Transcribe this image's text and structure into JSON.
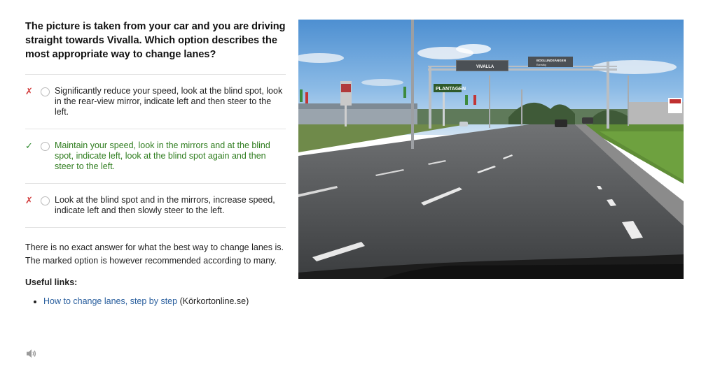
{
  "question": "The picture is taken from your car and you are driving straight towards Vivalla. Which option describes the most appropriate way to change lanes?",
  "options": [
    {
      "mark": "✗",
      "status": "wrong",
      "text": "Significantly reduce your speed, look at the blind spot, look in the rear-view mirror, indicate left and then steer to the left."
    },
    {
      "mark": "✓",
      "status": "correct",
      "text": "Maintain your speed, look in the mirrors and at the blind spot, indicate left, look at the blind spot again and then steer to the left."
    },
    {
      "mark": "✗",
      "status": "wrong",
      "text": "Look at the blind spot and in the mirrors, increase speed, indicate left and then slowly steer to the left."
    }
  ],
  "explanation": "There is no exact answer for what the best way to change lanes is. The marked option is however recommended according to many.",
  "useful_links": {
    "title": "Useful links:",
    "items": [
      {
        "link_text": "How to change lanes, step by step",
        "source": "(Körkortonline.se)"
      }
    ]
  },
  "photo": {
    "signs": {
      "vivalla": "VIVALLA",
      "boglundsangen": "BOGLUNDSÄNGEN",
      "boglundsangen_sub": "Eurovikg",
      "plantagen": "PLANTAGEN"
    }
  },
  "colors": {
    "wrong": "#d23b3b",
    "correct": "#2f7d1f",
    "link": "#2a5f9e"
  },
  "icons": {
    "speaker": "speaker-icon",
    "wrong": "cross-icon",
    "correct": "check-icon"
  }
}
